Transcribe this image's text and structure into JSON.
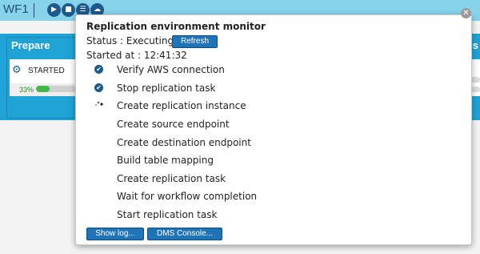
{
  "toolbar": {
    "title": "WF1",
    "icons": [
      "play-icon",
      "stop-icon",
      "list-icon",
      "cloud-icon"
    ]
  },
  "stage": {
    "title": "Prepare",
    "right_title": "es",
    "status": "STARTED",
    "progress_label": "33%",
    "progress": 0.33
  },
  "popup": {
    "title": "Replication environment monitor",
    "status_label": "Status : Executing",
    "refresh_label": "Refresh",
    "started_label": "Started at : 12:41:32",
    "steps": [
      {
        "label": "Verify AWS connection",
        "state": "done"
      },
      {
        "label": "Stop replication task",
        "state": "done"
      },
      {
        "label": "Create replication instance",
        "state": "running"
      },
      {
        "label": "Create source endpoint",
        "state": "pending"
      },
      {
        "label": "Create destination endpoint",
        "state": "pending"
      },
      {
        "label": "Build table mapping",
        "state": "pending"
      },
      {
        "label": "Create replication task",
        "state": "pending"
      },
      {
        "label": "Wait for workflow completion",
        "state": "pending"
      },
      {
        "label": "Start replication task",
        "state": "pending"
      }
    ],
    "show_log_label": "Show log...",
    "dms_console_label": "DMS Console..."
  },
  "colors": {
    "accent": "#1fa3d6",
    "button": "#1f73b7",
    "progress": "#44b94a"
  }
}
